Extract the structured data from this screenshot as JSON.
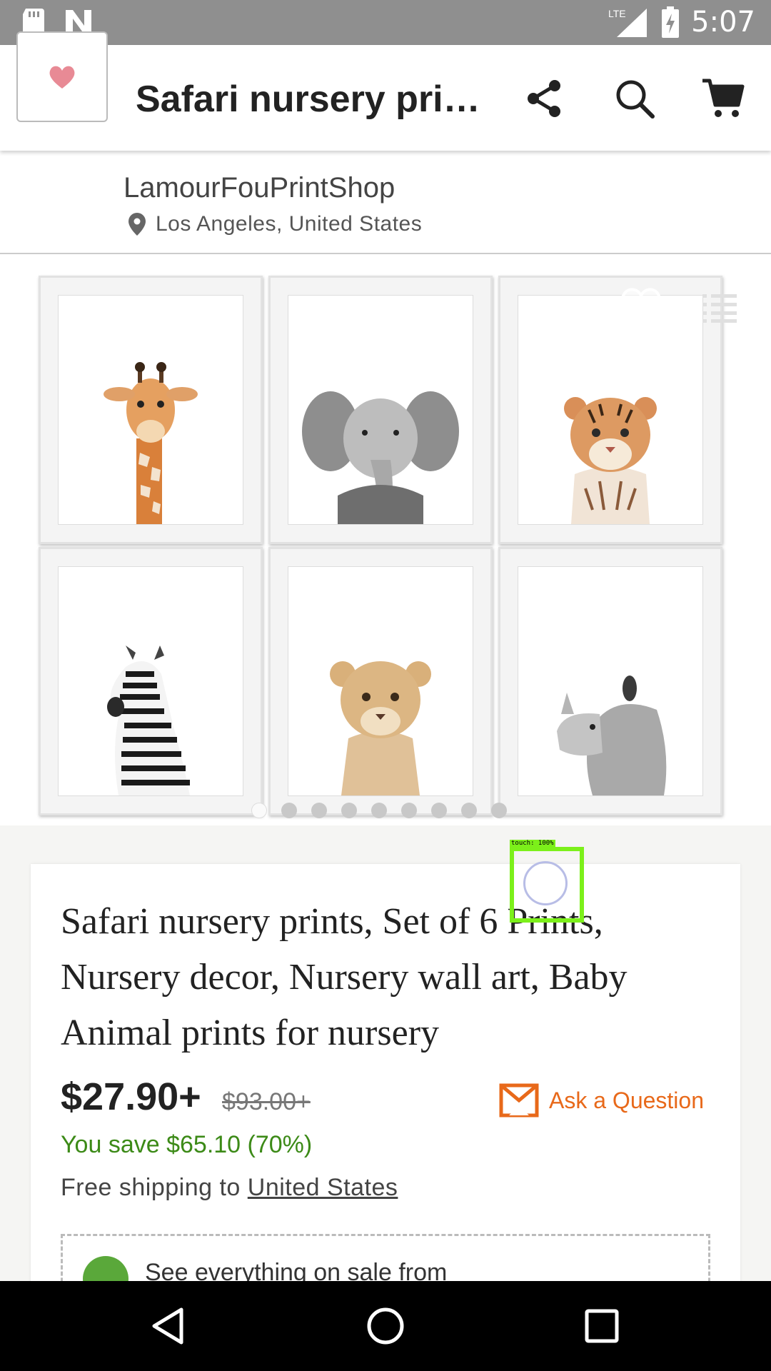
{
  "status_bar": {
    "time": "5:07",
    "network": "LTE"
  },
  "app_bar": {
    "title": "Safari nursery pri…"
  },
  "shop": {
    "name": "LamourFouPrintShop",
    "location": "Los Angeles, United States"
  },
  "gallery": {
    "frames": [
      "giraffe",
      "elephant",
      "tiger",
      "zebra",
      "lion",
      "rhino"
    ],
    "page_count": 9,
    "active_index": 0
  },
  "listing": {
    "title": "Safari nursery prints, Set of 6 Prints, Nursery decor, Nursery wall art, Baby Animal prints for nursery",
    "price": "$27.90+",
    "original_price": "$93.00+",
    "savings": "You save $65.10 (70%)",
    "shipping_prefix": "Free shipping to ",
    "shipping_country": "United States",
    "ask_question": "Ask a Question",
    "sale_text": "See everything on sale from"
  },
  "touch_overlay": {
    "label": "touch: 100%"
  },
  "colors": {
    "accent": "#e8691a",
    "savings": "#3c8a17",
    "status_bar": "#8f8f8f"
  }
}
